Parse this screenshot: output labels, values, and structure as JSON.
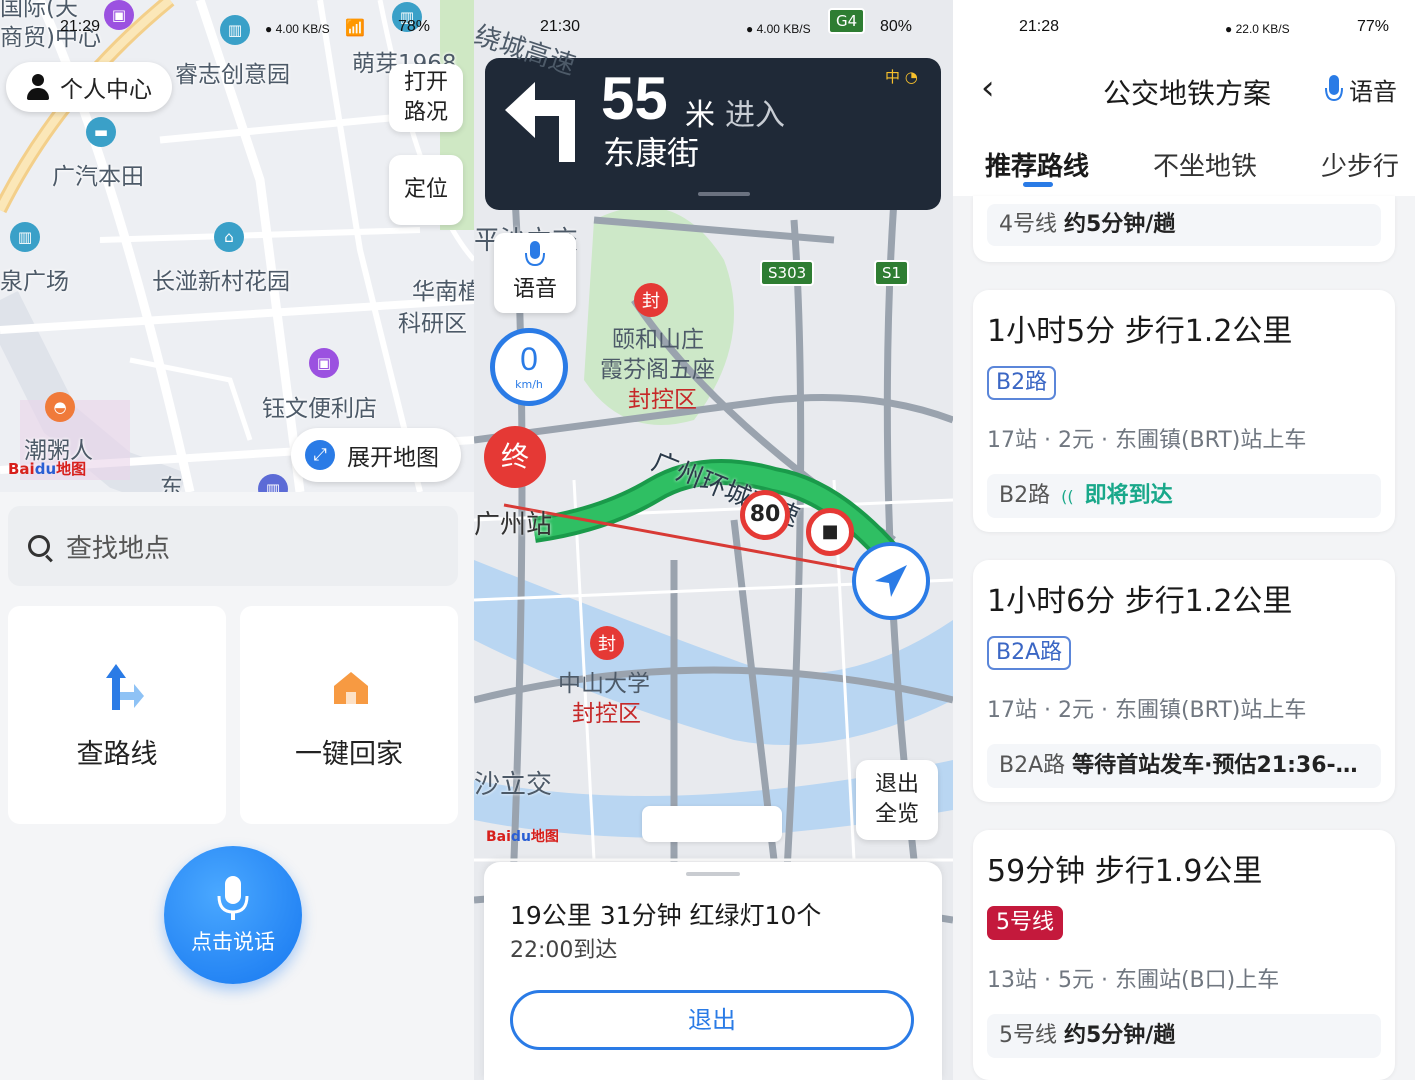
{
  "panel1": {
    "status": {
      "time": "21:29",
      "net": "4.00 KB/S",
      "battery": "78%"
    },
    "map_labels": [
      "国际(天",
      "商贸)中心",
      "睿志创意园",
      "萌芽1968",
      "广汽本田",
      "泉广场",
      "长湴新村花园",
      "华南植",
      "科研区",
      "钰文便利店",
      "潮粥人",
      "东"
    ],
    "user_center": "个人中心",
    "traffic_btn": "打开路况",
    "locate_btn": "定位",
    "expand_map": "展开地图",
    "logo": "Bai地图",
    "search_placeholder": "查找地点",
    "route_btn": "查路线",
    "home_btn": "一键回家",
    "voice_btn": "点击说话"
  },
  "panel2": {
    "status": {
      "time": "21:30",
      "net": "4.00 KB/S",
      "battery": "80%"
    },
    "distance": "55",
    "unit": "米",
    "action": "进入",
    "street": "东康街",
    "signal_label": "中",
    "voice": "语音",
    "speed": "0",
    "speed_unit": "km/h",
    "end_label": "终",
    "highway_label": "广州环城高速",
    "speed_limit": "80",
    "map_labels": [
      "绕城高速",
      "平沙立交",
      "颐和山庄",
      "霞芬阁五座",
      "封控区",
      "广州站",
      "中山大学",
      "封控区",
      "沙立交"
    ],
    "seal": "封",
    "route_tags": [
      "S303",
      "S1",
      "G4"
    ],
    "exit_overview": "退出全览",
    "logo": "Bai地图",
    "summary": "19公里 31分钟 红绿灯10个",
    "eta": "22:00到达",
    "exit": "退出"
  },
  "panel3": {
    "status": {
      "time": "21:28",
      "net": "22.0 KB/S",
      "battery": "77%"
    },
    "title": "公交地铁方案",
    "voice": "语音",
    "tabs": [
      "推荐路线",
      "不坐地铁",
      "少步行"
    ],
    "top_partial": {
      "line": "4号线",
      "freq": "约5分钟/趟"
    },
    "routes": [
      {
        "title": "1小时5分  步行1.2公里",
        "tag": "B2路",
        "meta": "17站 · 2元 · 东圃镇(BRT)站上车",
        "sub_line": "B2路",
        "sub_status": "即将到达"
      },
      {
        "title": "1小时6分  步行1.2公里",
        "tag": "B2A路",
        "meta": "17站 · 2元 · 东圃镇(BRT)站上车",
        "sub_line": "B2A路",
        "sub_status": "等待首站发车·预估21:36-…"
      },
      {
        "title": "59分钟  步行1.9公里",
        "tag": "5号线",
        "meta": "13站 · 5元 · 东圃站(B口)上车",
        "sub_line": "5号线",
        "sub_status": "约5分钟/趟"
      }
    ],
    "colors": {
      "accent": "#2a6fe8",
      "metro5": "#c4193c",
      "arriving": "#19a88a"
    }
  }
}
